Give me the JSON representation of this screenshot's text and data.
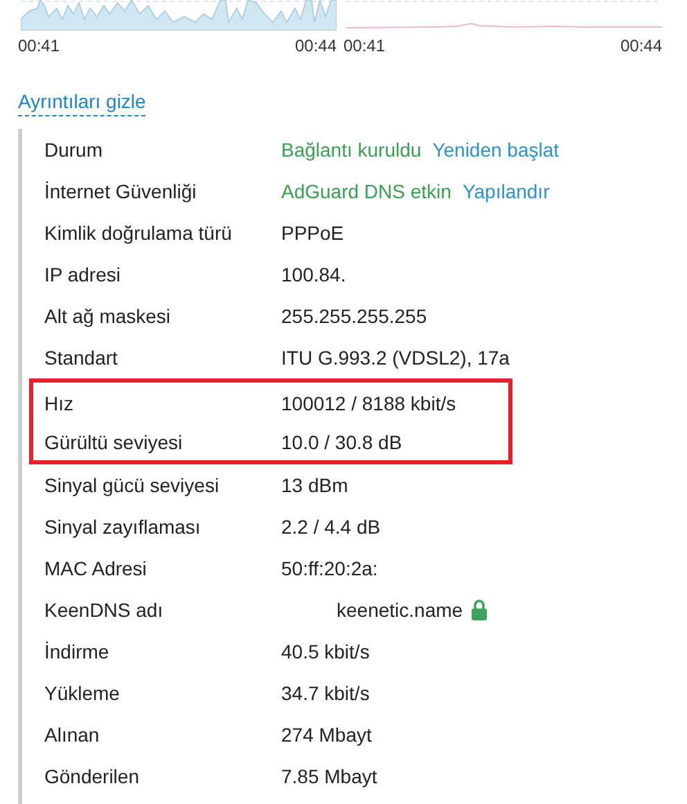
{
  "charts": [
    {
      "kind": "download",
      "time_start": "00:41",
      "time_end": "00:44"
    },
    {
      "kind": "upload",
      "time_start": "00:41",
      "time_end": "00:44"
    }
  ],
  "details_link": "Ayrıntıları gizle",
  "rows": [
    {
      "label": "Durum",
      "value": "Bağlantı kuruldu",
      "kind": "status",
      "action": "Yeniden başlat",
      "highlighted": false
    },
    {
      "label": "İnternet Güvenliği",
      "value": "AdGuard DNS etkin",
      "kind": "status",
      "action": "Yapılandır",
      "highlighted": false
    },
    {
      "label": "Kimlik doğrulama türü",
      "value": "PPPoE",
      "kind": "plain",
      "highlighted": false
    },
    {
      "label": "IP adresi",
      "value": "100.84.",
      "kind": "plain",
      "highlighted": false
    },
    {
      "label": "Alt ağ maskesi",
      "value": "255.255.255.255",
      "kind": "plain",
      "highlighted": false
    },
    {
      "label": "Standart",
      "value": "ITU G.993.2 (VDSL2), 17a",
      "kind": "plain",
      "highlighted": false
    },
    {
      "label": "Hız",
      "value": "100012 / 8188 kbit/s",
      "kind": "plain",
      "highlighted": true
    },
    {
      "label": "Gürültü seviyesi",
      "value": "10.0 / 30.8 dB",
      "kind": "plain",
      "highlighted": true
    },
    {
      "label": "Sinyal gücü seviyesi",
      "value": "13 dBm",
      "kind": "plain",
      "highlighted": false
    },
    {
      "label": "Sinyal zayıflaması",
      "value": "2.2 / 4.4 dB",
      "kind": "plain",
      "highlighted": false
    },
    {
      "label": "MAC Adresi",
      "value": "50:ff:20:2a:",
      "kind": "plain",
      "highlighted": false
    },
    {
      "label": "KeenDNS adı",
      "value": "keenetic.name",
      "kind": "secure-domain",
      "highlighted": false
    },
    {
      "label": "İndirme",
      "value": "40.5 kbit/s",
      "kind": "plain",
      "highlighted": false
    },
    {
      "label": "Yükleme",
      "value": "34.7 kbit/s",
      "kind": "plain",
      "highlighted": false
    },
    {
      "label": "Alınan",
      "value": "274 Mbayt",
      "kind": "plain",
      "highlighted": false
    },
    {
      "label": "Gönderilen",
      "value": "7.85 Mbayt",
      "kind": "plain",
      "highlighted": false
    }
  ]
}
